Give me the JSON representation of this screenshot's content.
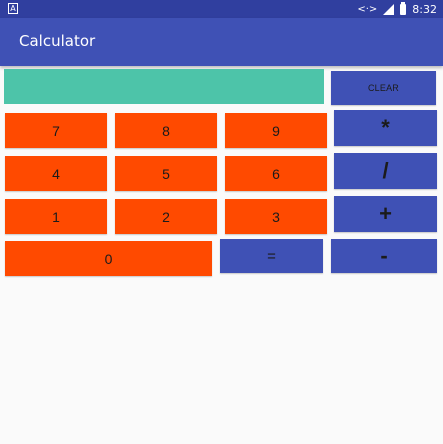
{
  "status_bar": {
    "time": "8:32",
    "left_icon": "android-notification-icon",
    "icons": [
      "vpn-key-icon",
      "signal-icon",
      "battery-icon"
    ]
  },
  "app_bar": {
    "title": "Calculator"
  },
  "display": {
    "value": ""
  },
  "buttons": {
    "clear": "CLEAR",
    "seven": "7",
    "eight": "8",
    "nine": "9",
    "four": "4",
    "five": "5",
    "six": "6",
    "one": "1",
    "two": "2",
    "three": "3",
    "zero": "0",
    "equals": "=",
    "multiply": "*",
    "divide": "/",
    "plus": "+",
    "minus": "-"
  },
  "colors": {
    "status_bar": "#303f9f",
    "app_bar": "#3f51b5",
    "display": "#4dc4a9",
    "number_button": "#ff4a00",
    "operator_button": "#3f51b5"
  }
}
